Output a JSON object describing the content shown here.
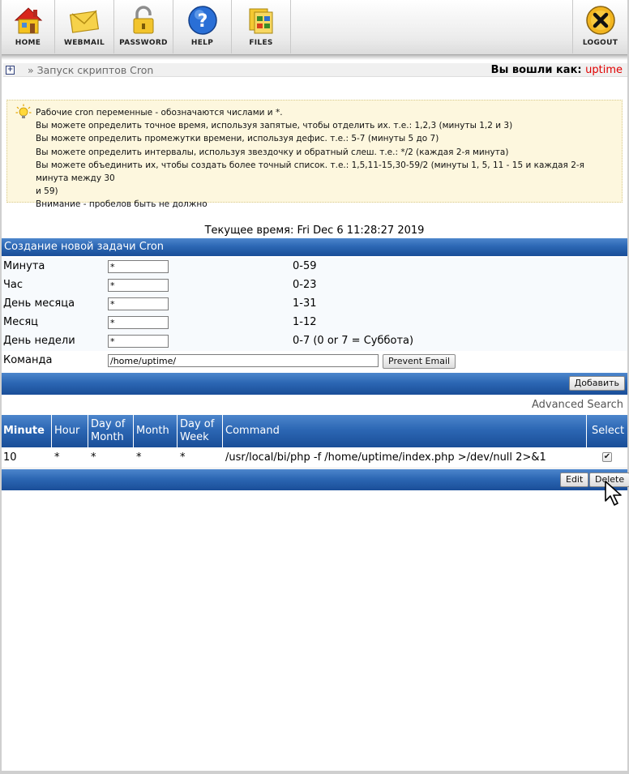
{
  "nav": {
    "home": "HOME",
    "webmail": "WEBMAIL",
    "password": "PASSWORD",
    "help": "HELP",
    "files": "FILES",
    "logout": "LOGOUT"
  },
  "breadcrumb": {
    "text": "» Запуск скриптов Cron"
  },
  "login": {
    "label": "Вы вошли как:",
    "user": "uptime"
  },
  "info": {
    "lines": [
      "Рабочие cron переменные - обозначаются числами и *.",
      "Вы можете определить точное время, используя запятые, чтобы отделить их. т.е.: 1,2,3 (минуты 1,2 и 3)",
      "Вы можете определить промежутки времени, используя дефис. т.е.: 5-7 (минуты 5 до 7)",
      "Вы можете определить интервалы, используя звездочку и обратный слеш. т.е.: */2 (каждая 2-я минута)",
      "Вы можете объединить их, чтобы создать более точный список. т.е.: 1,5,11-15,30-59/2 (минуты 1, 5, 11 - 15 и каждая 2-я минута между 30",
      "и 59)",
      "Внимание - пробелов быть не должно"
    ]
  },
  "current_time": "Текущее время: Fri Dec 6 11:28:27 2019",
  "form": {
    "title": "Создание новой задачи Cron",
    "rows": [
      {
        "label": "Минута",
        "value": "*",
        "range": "0-59"
      },
      {
        "label": "Час",
        "value": "*",
        "range": "0-23"
      },
      {
        "label": "День месяца",
        "value": "*",
        "range": "1-31"
      },
      {
        "label": "Месяц",
        "value": "*",
        "range": "1-12"
      },
      {
        "label": "День недели",
        "value": "*",
        "range": "0-7 (0 or 7 = Суббота)"
      }
    ],
    "command_label": "Команда",
    "command_value": "/home/uptime/",
    "prevent_email": "Prevent Email",
    "add": "Добавить"
  },
  "advanced_search": "Advanced Search",
  "table": {
    "headers": {
      "minute": "Minute",
      "hour": "Hour",
      "dom_1": "Day of",
      "dom_2": "Month",
      "month": "Month",
      "dow_1": "Day of",
      "dow_2": "Week",
      "command": "Command",
      "select": "Select"
    },
    "rows": [
      {
        "minute": "10",
        "hour": "*",
        "dom": "*",
        "month": "*",
        "dow": "*",
        "command": "/usr/local/bi/php -f /home/uptime/index.php >/dev/null 2>&1",
        "checked": "✔"
      }
    ],
    "edit": "Edit",
    "delete": "Delete"
  }
}
